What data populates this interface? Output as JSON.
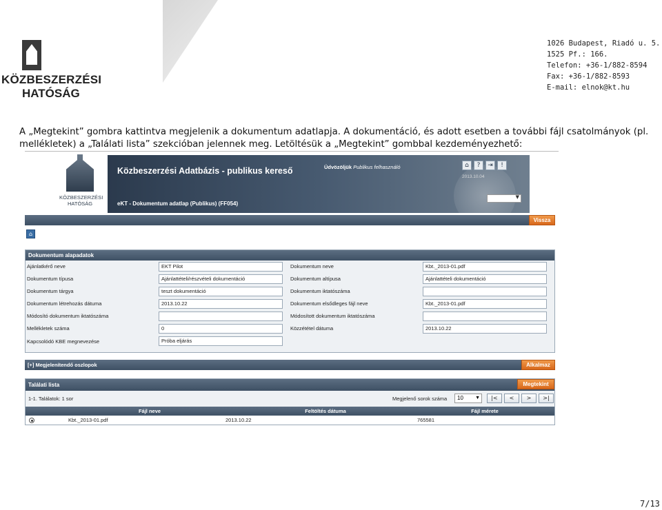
{
  "header": {
    "logo_line1": "KÖZBESZERZÉSI",
    "logo_line2": "HATÓSÁG",
    "address": [
      "1026 Budapest, Riadó u. 5.",
      "1525 Pf.: 166.",
      "Telefon: +36-1/882-8594",
      "Fax: +36-1/882-8593",
      "E-mail: elnok@kt.hu"
    ]
  },
  "intro_text": "A „Megtekint” gombra kattintva megjelenik a dokumentum adatlapja. A dokumentáció, és adott esetben a további fájl csatolmányok (pl. mellékletek) a „Találati lista” szekcióban jelennek meg. Letöltésük a „Megtekint” gombbal kezdeményezhető:",
  "app": {
    "logo_line1": "KÖZBESZERZÉSI",
    "logo_line2": "HATÓSÁG",
    "title": "Közbeszerzési Adatbázis - publikus kereső",
    "welcome_bold": "Üdvözöljük",
    "welcome_user": "Publikus felhasználó",
    "date": "2013.10.04",
    "subtitle": "eKT - Dokumentum adatlap (Publikus) (FF054)",
    "icons": [
      "home-icon",
      "help-icon",
      "logout-icon",
      "alert-icon"
    ],
    "back_button": "Vissza",
    "panel_title": "Dokumentum alapadatok",
    "left_fields": [
      {
        "label": "Ajánlatkérő neve",
        "value": "EKT Pilot"
      },
      {
        "label": "Dokumentum típusa",
        "value": "Ajánlattételi/részvételi dokumentáció"
      },
      {
        "label": "Dokumentum tárgya",
        "value": "teszt dokumentáció"
      },
      {
        "label": "Dokumentum létrehozás dátuma",
        "value": "2013.10.22"
      },
      {
        "label": "Módosító dokumentum iktatószáma",
        "value": ""
      },
      {
        "label": "Mellékletek száma",
        "value": "0"
      },
      {
        "label": "Kapcsolódó KBE megnevezése",
        "value": "Próba eljárás"
      }
    ],
    "right_fields": [
      {
        "label": "Dokumentum neve",
        "value": "Kbt._2013-01.pdf"
      },
      {
        "label": "Dokumentum altípusa",
        "value": "Ajánlattételi dokumentáció"
      },
      {
        "label": "Dokumentum iktatószáma",
        "value": ""
      },
      {
        "label": "Dokumentum elsődleges fájl neve",
        "value": "Kbt._2013-01.pdf"
      },
      {
        "label": "Módosított dokumentum iktatószáma",
        "value": ""
      },
      {
        "label": "Közzététel dátuma",
        "value": "2013.10.22"
      }
    ],
    "columns_bar": "[+] Megjelenítendő oszlopok",
    "apply_button": "Alkalmaz",
    "results_title": "Találati lista",
    "view_button": "Megtekint",
    "results_info": "1-1. Találatok: 1 sor",
    "rows_label": "Megjelenő sorok száma",
    "rows_value": "10",
    "pager": [
      "|<",
      "<",
      ">",
      ">|"
    ],
    "table_headers": [
      "Fájl neve",
      "Feltöltés dátuma",
      "Fájl mérete"
    ],
    "table_row": [
      "Kbt._2013-01.pdf",
      "2013.10.22",
      "765581"
    ]
  },
  "page_number": "7/13"
}
